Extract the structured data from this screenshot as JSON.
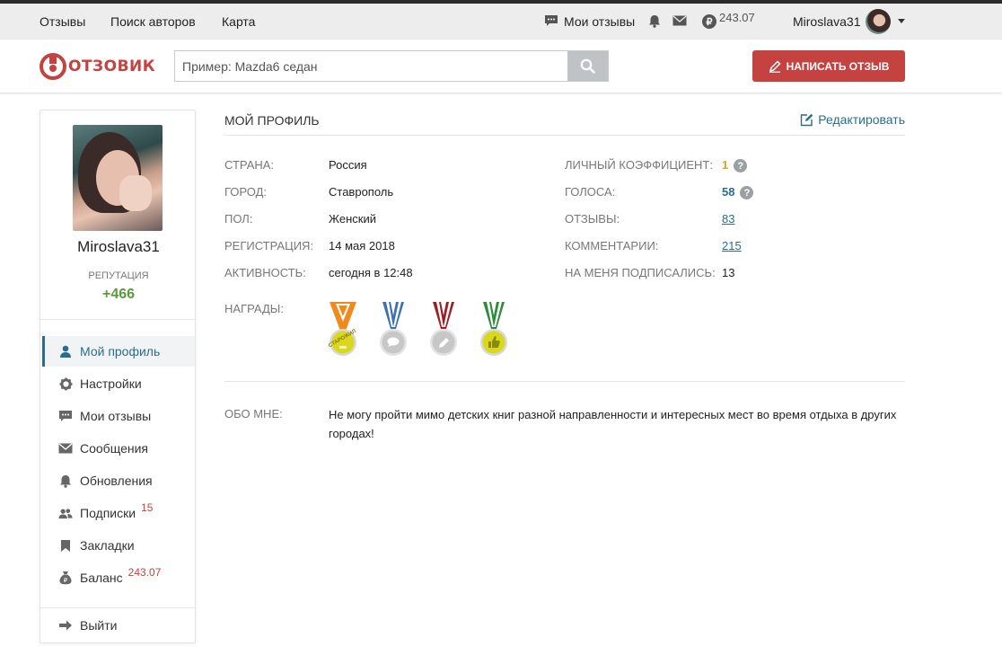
{
  "topbar": {
    "nav": [
      "Отзывы",
      "Поиск авторов",
      "Карта"
    ],
    "my_reviews": "Мои отзывы",
    "balance": "243.07",
    "username": "Miroslava31"
  },
  "header": {
    "logo_text": "ОТЗОВИК",
    "search_placeholder": "Пример: Mazda6 седан",
    "write_button": "НАПИСАТЬ ОТЗЫВ"
  },
  "sidebar": {
    "username": "Miroslava31",
    "reputation_label": "РЕПУТАЦИЯ",
    "reputation_value": "+466",
    "menu": [
      {
        "label": "Мой профиль",
        "icon": "user-icon",
        "badge": ""
      },
      {
        "label": "Настройки",
        "icon": "gear-icon",
        "badge": ""
      },
      {
        "label": "Мои отзывы",
        "icon": "comment-icon",
        "badge": ""
      },
      {
        "label": "Сообщения",
        "icon": "envelope-icon",
        "badge": ""
      },
      {
        "label": "Обновления",
        "icon": "bell-icon",
        "badge": ""
      },
      {
        "label": "Подписки",
        "icon": "users-icon",
        "badge": "15"
      },
      {
        "label": "Закладки",
        "icon": "bookmark-icon",
        "badge": ""
      },
      {
        "label": "Баланс",
        "icon": "money-bag-icon",
        "badge": "243.07"
      }
    ],
    "logout": "Выйти"
  },
  "profile": {
    "title": "МОЙ ПРОФИЛЬ",
    "edit": "Редактировать",
    "left": [
      {
        "label": "СТРАНА:",
        "value": "Россия"
      },
      {
        "label": "ГОРОД:",
        "value": "Ставрополь"
      },
      {
        "label": "ПОЛ:",
        "value": "Женский"
      },
      {
        "label": "РЕГИСТРАЦИЯ:",
        "value": "14 мая 2018"
      },
      {
        "label": "АКТИВНОСТЬ:",
        "value": "сегодня в 12:48"
      }
    ],
    "right": [
      {
        "label": "ЛИЧНЫЙ КОЭФФИЦИЕНТ:",
        "value": "1"
      },
      {
        "label": "ГОЛОСА:",
        "value": "58"
      },
      {
        "label": "ОТЗЫВЫ:",
        "value": "83"
      },
      {
        "label": "КОММЕНТАРИИ:",
        "value": "215"
      },
      {
        "label": "НА МЕНЯ ПОДПИСАЛИСЬ:",
        "value": "13"
      }
    ],
    "awards_label": "НАГРАДЫ:",
    "medal_text": "СТАРОЖИЛ",
    "about_label": "ОБО МНЕ:",
    "about_text": "Не могу пройти мимо детских книг разной направленности и интересных мест во время отдыха в других городах!"
  },
  "colors": {
    "accent": "#c4423f",
    "link": "#2a6e8c",
    "reputation": "#5a9a3c",
    "coefficient": "#e0a020"
  }
}
